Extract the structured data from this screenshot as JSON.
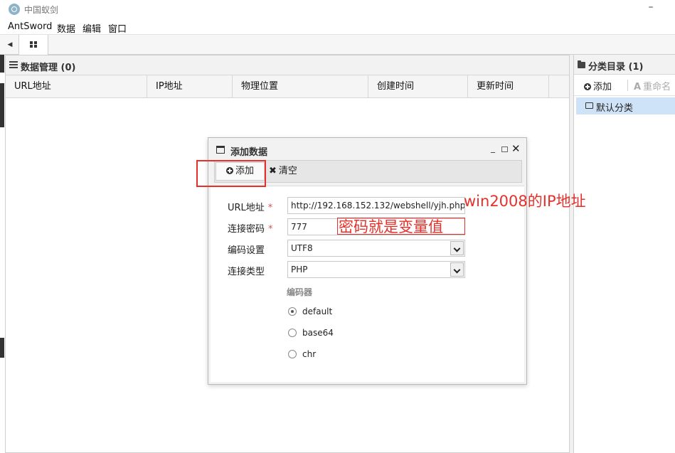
{
  "window": {
    "title": "中国蚁剑",
    "minimize_glyph": "–"
  },
  "menu": {
    "items": [
      "AntSword",
      "数据",
      "编辑",
      "窗口"
    ]
  },
  "tabs": {
    "scroll_left_glyph": "◀"
  },
  "data_panel": {
    "title": "数据管理 (0)",
    "columns": [
      "URL地址",
      "IP地址",
      "物理位置",
      "创建时间",
      "更新时间"
    ]
  },
  "category_panel": {
    "title": "分类目录 (1)",
    "add_label": "添加",
    "rename_label": "重命名",
    "rename_icon": "A",
    "default_item": "默认分类"
  },
  "dialog": {
    "title": "添加数据",
    "minimize_glyph": "_",
    "close_glyph": "✕",
    "add_label": "添加",
    "clear_label": "清空",
    "clear_glyph": "✖",
    "fields": {
      "url_label": "URL地址",
      "url_value": "http://192.168.152.132/webshell/yjh.php",
      "password_label": "连接密码",
      "password_value": "777",
      "encoding_label": "编码设置",
      "encoding_value": "UTF8",
      "type_label": "连接类型",
      "type_value": "PHP",
      "required_mark": "*"
    },
    "encoder": {
      "heading": "编码器",
      "options": [
        "default",
        "base64",
        "chr"
      ],
      "selected": "default"
    }
  },
  "annotations": {
    "ip_note": "win2008的IP地址",
    "password_note": "密码就是变量值",
    "color": "#e8302a"
  }
}
